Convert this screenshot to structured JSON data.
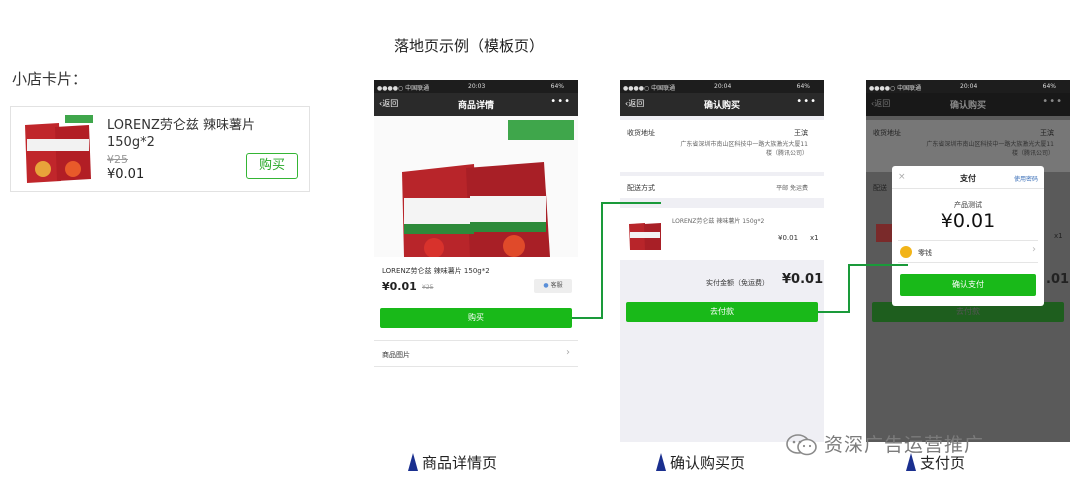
{
  "shop_card": {
    "title": "小店卡片：",
    "product_name": "LORENZ劳仑兹 辣味薯片150g*2",
    "original_price": "¥25",
    "price": "¥0.01",
    "buy_label": "购买"
  },
  "section_title": "落地页示例（模板页）",
  "status": {
    "carrier": "●●●●○ 中国联通 ",
    "time1": "20:03",
    "time2": "20:04",
    "time3": "20:04",
    "battery": "64% "
  },
  "detail_page": {
    "back": "返回",
    "title": "商品详情",
    "more": "•••",
    "product_name": "LORENZ劳仑兹 辣味薯片 150g*2",
    "price": "¥0.01",
    "original_price": "¥25",
    "service": "客服",
    "buy_label": "购买",
    "pictures_label": "商品图片",
    "caption": "商品详情页"
  },
  "confirm_page": {
    "back": "返回",
    "title": "确认购买",
    "more": "•••",
    "address_label": "收货地址",
    "receiver": "王滨",
    "address": "广东省深圳市南山区科技中一路大族激光大厦11楼（腾讯公司）",
    "shipping_label": "配送方式",
    "shipping_value": "平邮 免运费",
    "item_name": "LORENZ劳仑兹 辣味薯片 150g*2",
    "item_price": "¥0.01",
    "item_qty": "x1",
    "total_label": "实付金额（免运费）",
    "total_value": "¥0.01",
    "pay_button": "去付款",
    "caption": "确认购买页"
  },
  "pay_page": {
    "back": "返回",
    "title": "确认购买",
    "more": "•••",
    "address_label": "收货地址",
    "receiver": "王滨",
    "address": "广东省深圳市南山区科技中一路大族激光大厦11楼（腾讯公司）",
    "shipping_short": "配送",
    "dialog_title": "支付",
    "use_password": "使用密码",
    "product_label": "产品测试",
    "amount": "¥0.01",
    "wallet": "零钱",
    "confirm_pay": "确认支付",
    "right_qty": "x1",
    "right_price": ".01",
    "bottom_button": "去付款",
    "caption": "支付页"
  },
  "watermark": "资深广告运营推广",
  "colors": {
    "green": "#19b919",
    "connector": "#1a9a3a",
    "triangle": "#1a2f8f"
  }
}
